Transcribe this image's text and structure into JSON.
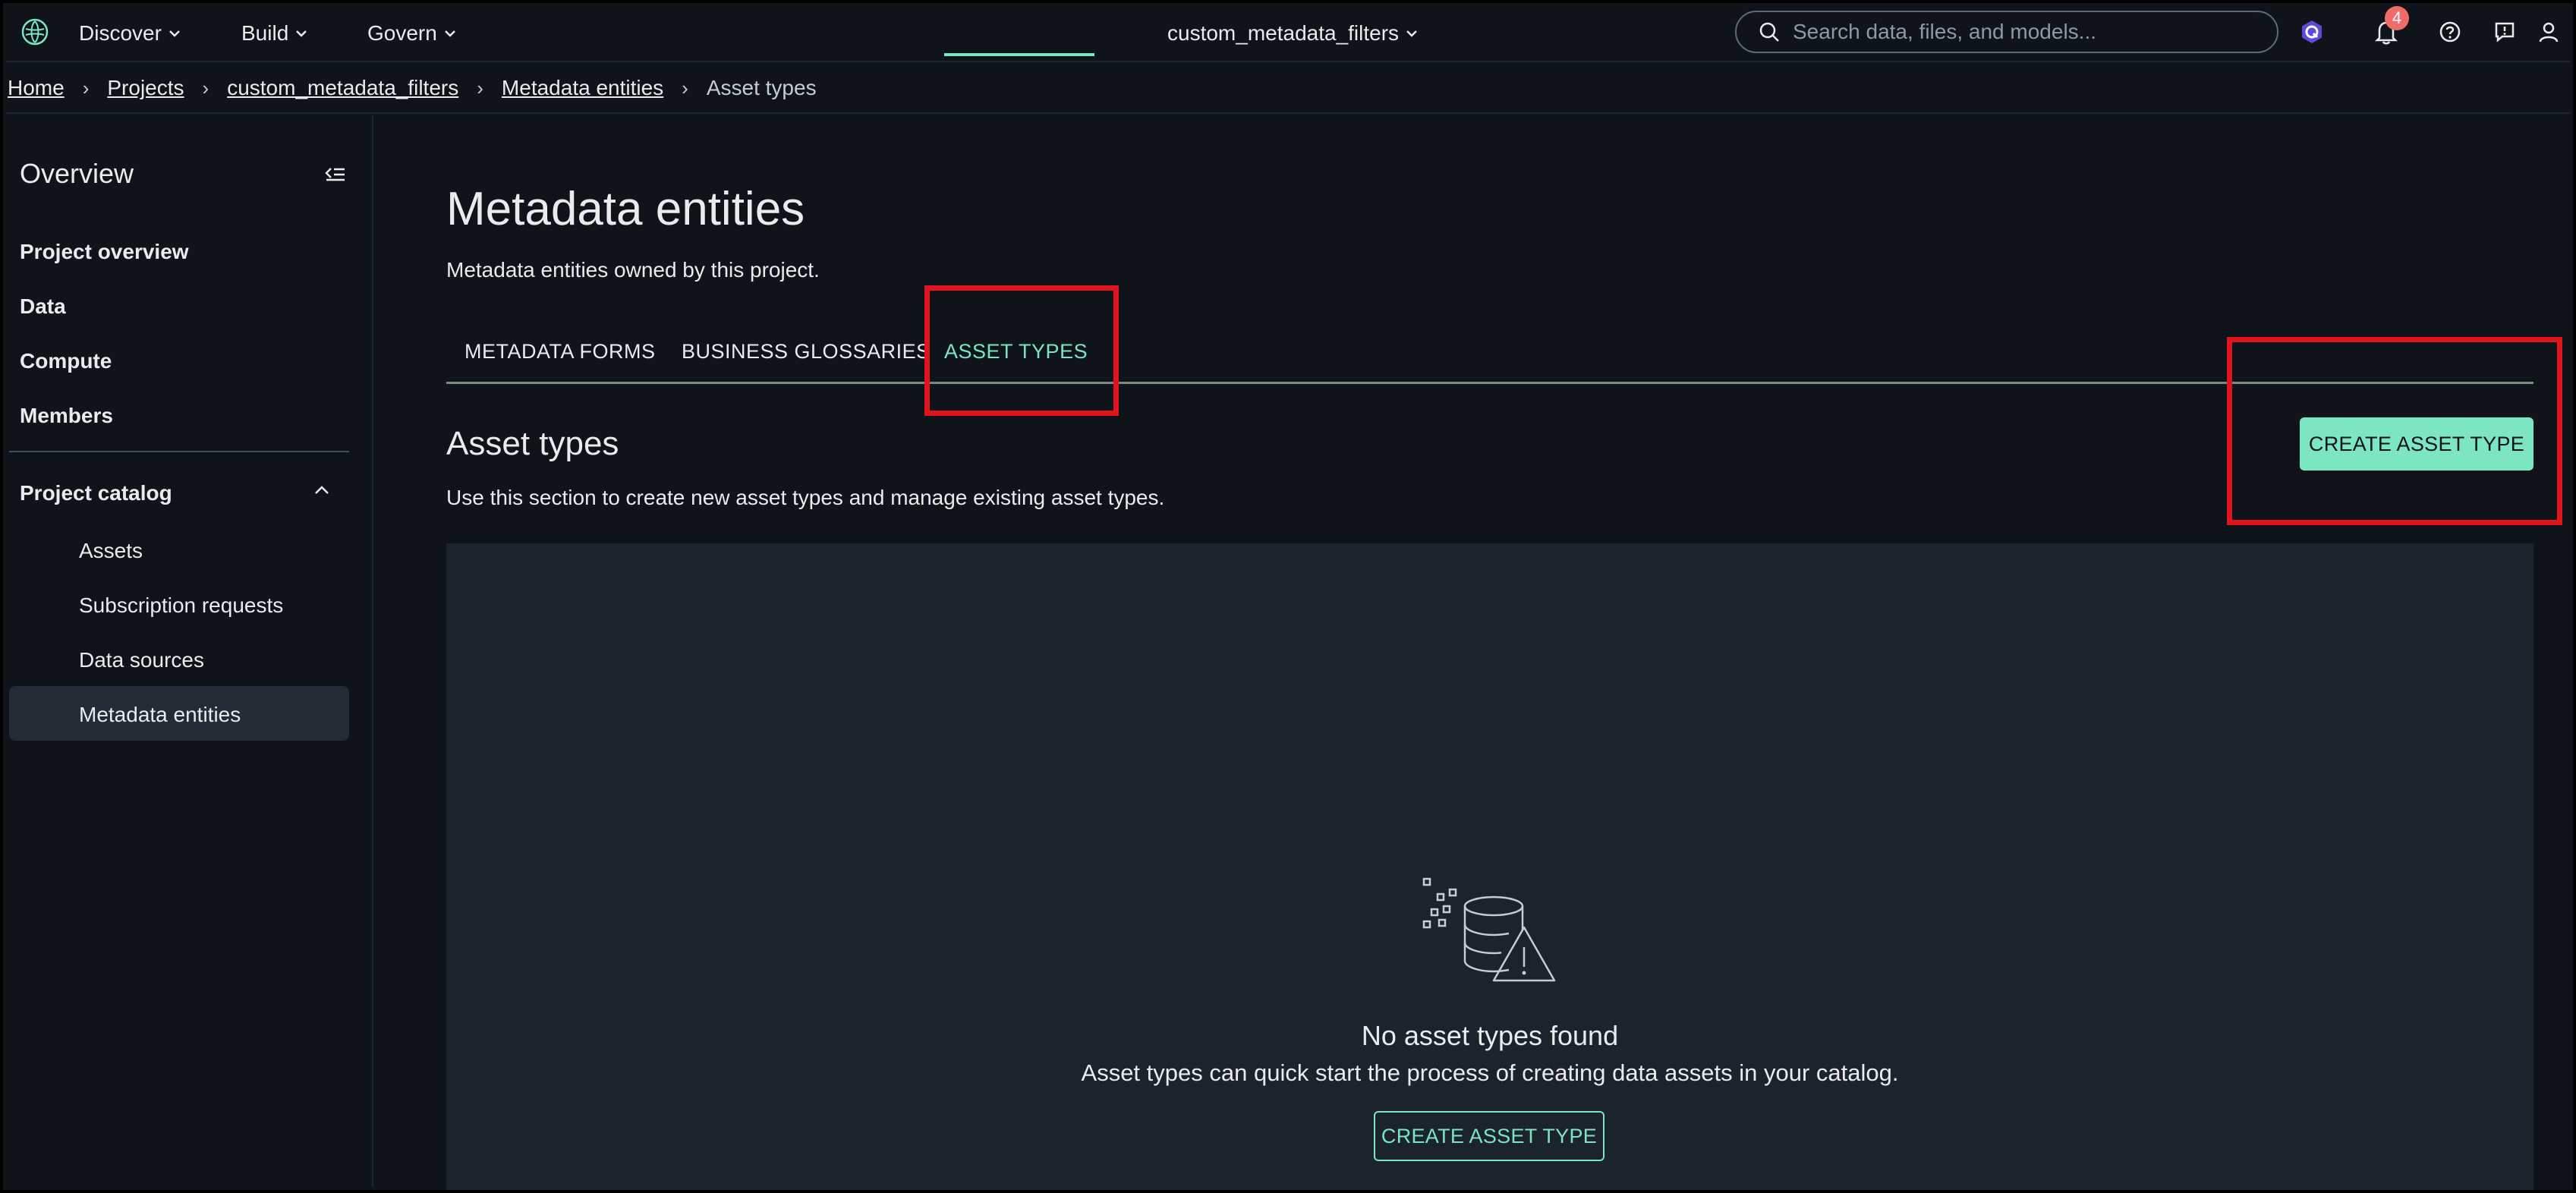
{
  "topnav": {
    "menus": [
      {
        "label": "Discover"
      },
      {
        "label": "Build"
      },
      {
        "label": "Govern"
      }
    ],
    "project_switch": "custom_metadata_filters",
    "search_placeholder": "Search data, files, and models...",
    "notification_count": "4"
  },
  "breadcrumb": {
    "items": [
      "Home",
      "Projects",
      "custom_metadata_filters",
      "Metadata entities"
    ],
    "current": "Asset types"
  },
  "sidebar": {
    "title": "Overview",
    "items": [
      "Project overview",
      "Data",
      "Compute",
      "Members"
    ],
    "catalog_label": "Project catalog",
    "catalog_items": [
      "Assets",
      "Subscription requests",
      "Data sources",
      "Metadata entities"
    ],
    "active_item": "Metadata entities"
  },
  "main": {
    "title": "Metadata entities",
    "description": "Metadata entities owned by this project.",
    "tabs": [
      {
        "label": "METADATA FORMS"
      },
      {
        "label": "BUSINESS GLOSSARIES"
      },
      {
        "label": "ASSET TYPES"
      }
    ],
    "active_tab": "ASSET TYPES",
    "section_title": "Asset types",
    "section_desc": "Use this section to create new asset types and manage existing asset types.",
    "create_button": "CREATE ASSET TYPE",
    "empty": {
      "title": "No asset types found",
      "description": "Asset types can quick start the process of creating data assets in your catalog.",
      "button": "CREATE ASSET TYPE"
    }
  },
  "colors": {
    "accent": "#7ce5c1",
    "background": "#0f141a",
    "panel": "#1b232d",
    "highlight": "#e0141e"
  }
}
